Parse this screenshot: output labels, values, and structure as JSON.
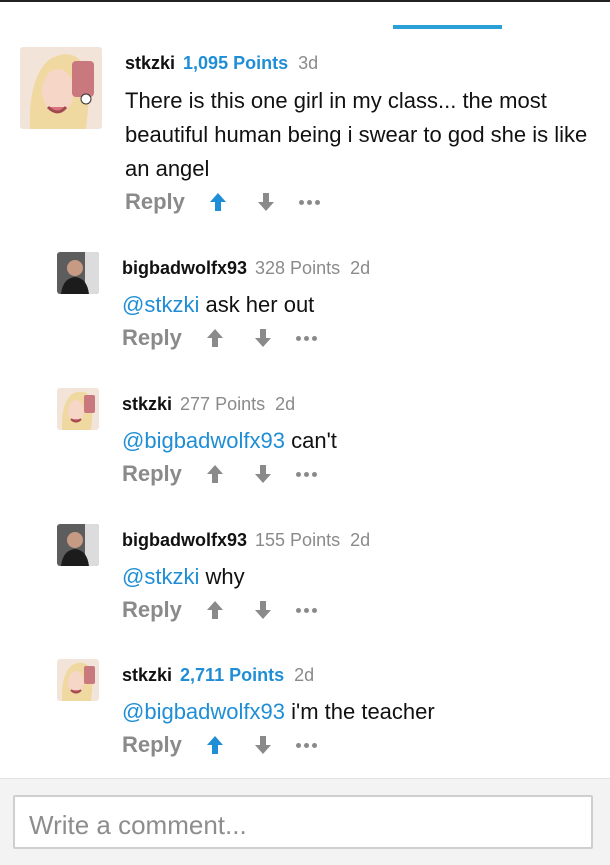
{
  "reply_label": "Reply",
  "colors": {
    "accent": "#1f8ed6",
    "muted": "#8a8a8a",
    "tab_indicator": "#2a9fd8"
  },
  "icons": {
    "upvote": "arrow-up-icon",
    "downvote": "arrow-down-icon",
    "more": "ellipsis-icon"
  },
  "comments": [
    {
      "user": "stkzki",
      "points": "1,095 Points",
      "age": "3d",
      "mention": "",
      "text": "There is this one girl in my class... the most beautiful human being i swear to god she is like an angel",
      "upvoted": true
    },
    {
      "user": "bigbadwolfx93",
      "points": "328 Points",
      "age": "2d",
      "mention": "@stkzki",
      "text": " ask her out",
      "upvoted": false
    },
    {
      "user": "stkzki",
      "points": "277 Points",
      "age": "2d",
      "mention": "@bigbadwolfx93",
      "text": " can't",
      "upvoted": false
    },
    {
      "user": "bigbadwolfx93",
      "points": "155 Points",
      "age": "2d",
      "mention": "@stkzki",
      "text": " why",
      "upvoted": false
    },
    {
      "user": "stkzki",
      "points": "2,711 Points",
      "age": "2d",
      "mention": "@bigbadwolfx93",
      "text": " i'm the teacher",
      "upvoted": true
    }
  ],
  "composer": {
    "placeholder": "Write a comment..."
  }
}
